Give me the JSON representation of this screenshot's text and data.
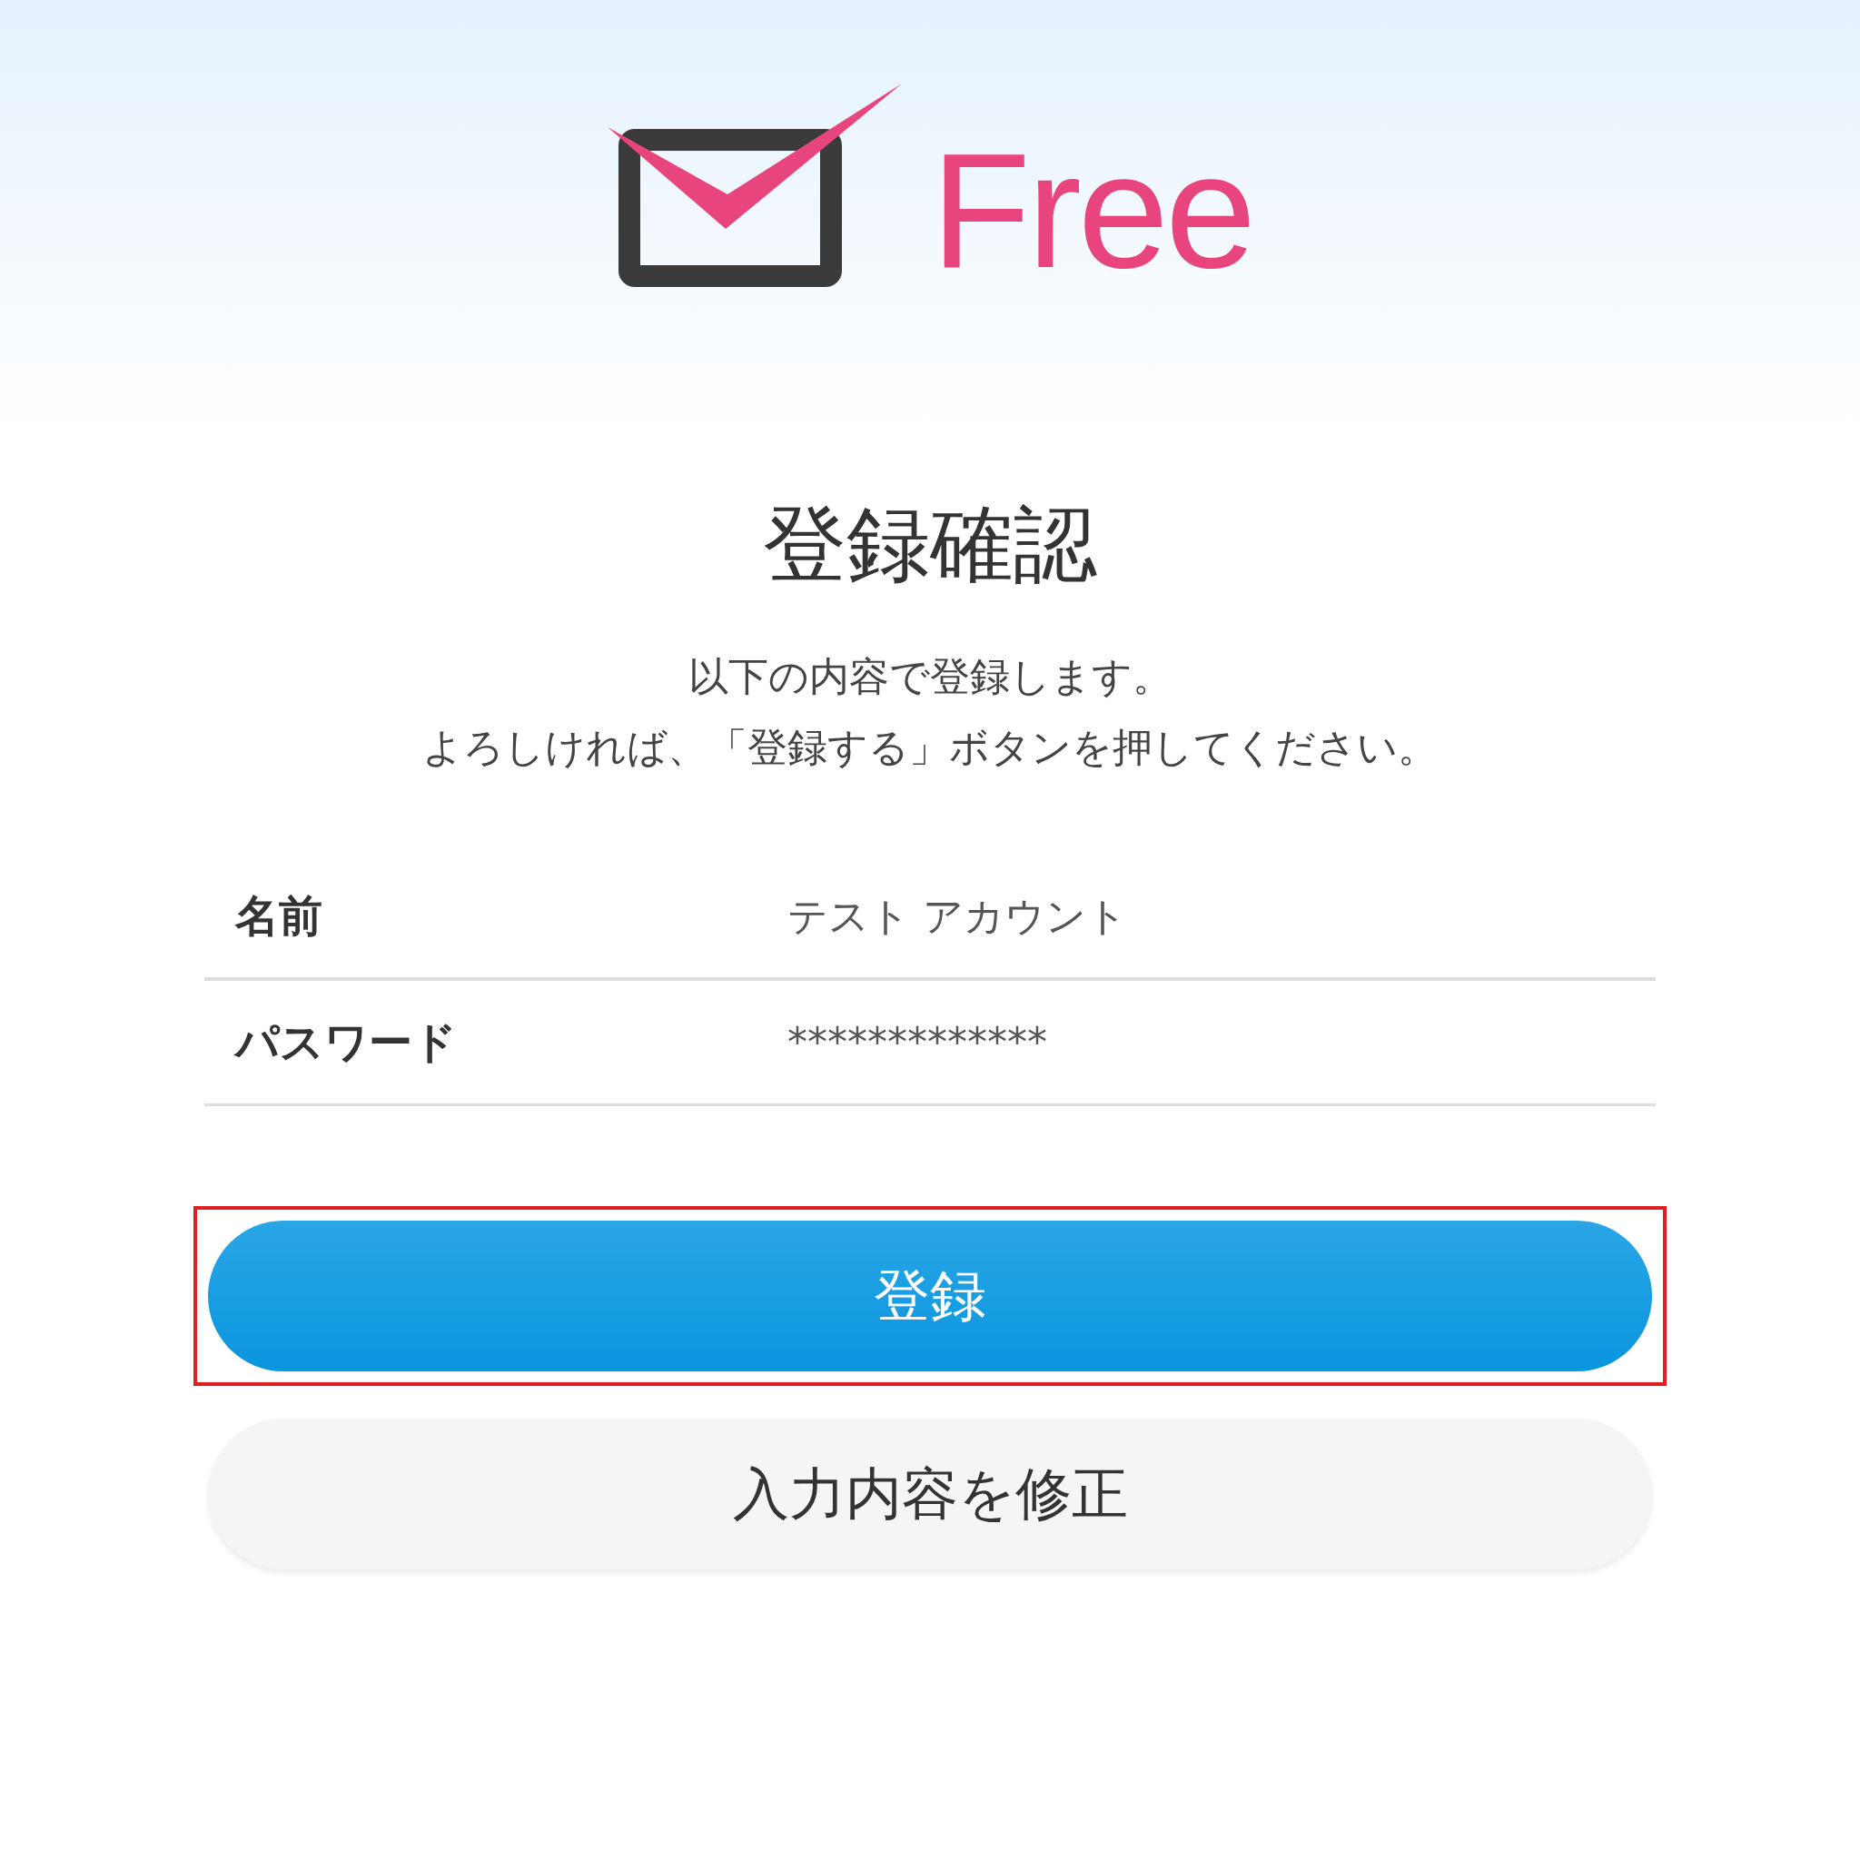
{
  "logo": {
    "text": "Free"
  },
  "title": "登録確認",
  "description": [
    "以下の内容で登録します。",
    "よろしければ、「登録する」ボタンを押してください。"
  ],
  "fields": [
    {
      "label": "名前",
      "value": "テスト アカウント"
    },
    {
      "label": "パスワード",
      "value": "*************"
    }
  ],
  "buttons": [
    {
      "label": "登録",
      "kind": "primary",
      "highlighted": true
    },
    {
      "label": "入力内容を修正",
      "kind": "secondary",
      "highlighted": false
    }
  ]
}
